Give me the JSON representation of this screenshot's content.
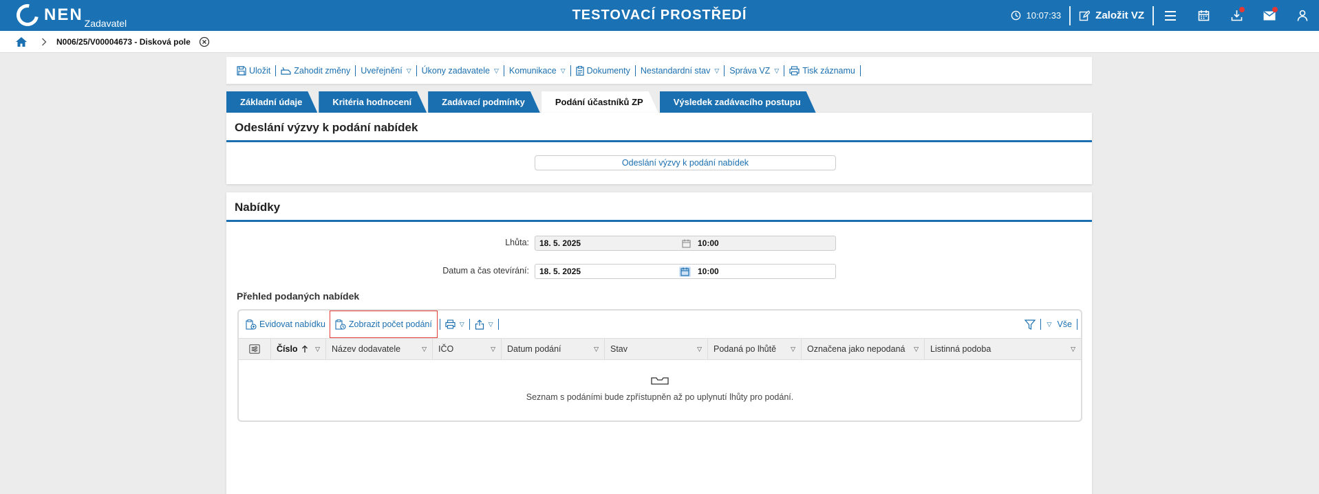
{
  "header": {
    "logo": "NEN",
    "logo_sub": "Zadavatel",
    "env_title": "TESTOVACÍ PROSTŘEDÍ",
    "clock": "10:07:33",
    "new_vz_label": "Založit VZ",
    "icons": [
      "menu-icon",
      "calendar-icon",
      "download-icon",
      "mail-icon",
      "user-icon"
    ]
  },
  "breadcrumb": {
    "item": "N006/25/V00004673 - Disková pole"
  },
  "toolbar": {
    "save": "Uložit",
    "discard": "Zahodit změny",
    "publish": "Uveřejnění",
    "actions": "Úkony zadavatele",
    "communication": "Komunikace",
    "documents": "Dokumenty",
    "nonstandard": "Nestandardní stav",
    "manage": "Správa VZ",
    "print": "Tisk záznamu"
  },
  "tabs": [
    {
      "label": "Základní údaje"
    },
    {
      "label": "Kritéria hodnocení"
    },
    {
      "label": "Zadávací podmínky"
    },
    {
      "label": "Podání účastníků ZP"
    },
    {
      "label": "Výsledek zadávacího postupu"
    }
  ],
  "invite_panel": {
    "title": "Odeslání výzvy k podání nabídek",
    "button": "Odeslání výzvy k podání nabídek"
  },
  "offers_panel": {
    "title": "Nabídky",
    "deadline_label": "Lhůta:",
    "deadline_date": "18. 5. 2025",
    "deadline_time": "10:00",
    "opening_label": "Datum a čas otevírání:",
    "opening_date": "18. 5. 2025",
    "opening_time": "10:00",
    "overview_title": "Přehled podaných nabídek"
  },
  "grid": {
    "register_offer": "Evidovat nabídku",
    "show_count": "Zobrazit počet podání",
    "all": "Vše",
    "columns": [
      "Číslo",
      "Název dodavatele",
      "IČO",
      "Datum podání",
      "Stav",
      "Podaná po lhůtě",
      "Označena jako nepodaná",
      "Listinná podoba"
    ],
    "empty_message": "Seznam s podáními bude zpřístupněn až po uplynutí lhůty pro podání."
  },
  "colors": {
    "brand": "#1a72b5",
    "highlight": "#e53935"
  }
}
